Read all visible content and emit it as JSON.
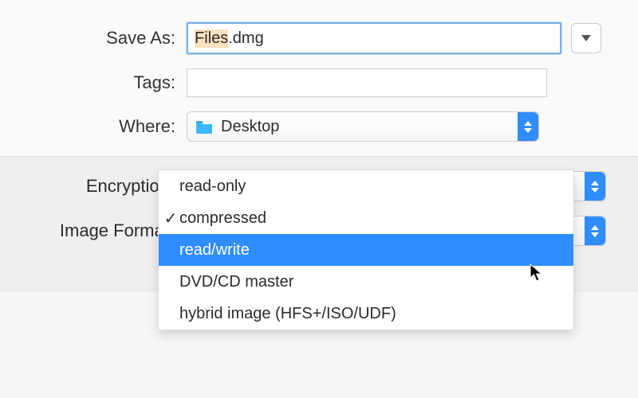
{
  "saveSheet": {
    "saveAs": {
      "label": "Save As:",
      "filename_base": "Files",
      "filename_ext": ".dmg"
    },
    "tags": {
      "label": "Tags:",
      "value": ""
    },
    "where": {
      "label": "Where:",
      "location": "Desktop"
    }
  },
  "options": {
    "encryption": {
      "label": "Encryption:"
    },
    "imageFormat": {
      "label": "Image Format:",
      "selected": "compressed",
      "highlighted": "read/write",
      "items": [
        {
          "label": "read-only",
          "checked": false
        },
        {
          "label": "compressed",
          "checked": true
        },
        {
          "label": "read/write",
          "checked": false
        },
        {
          "label": "DVD/CD master",
          "checked": false
        },
        {
          "label": "hybrid image (HFS+/ISO/UDF)",
          "checked": false
        }
      ]
    }
  }
}
